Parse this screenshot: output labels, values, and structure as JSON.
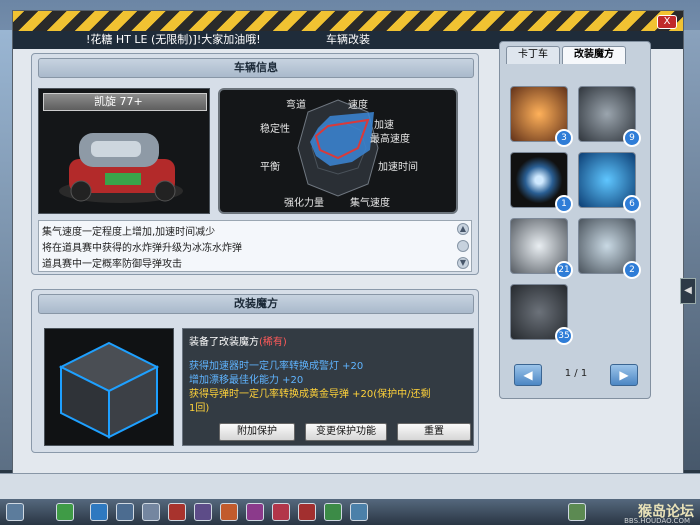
{
  "window": {
    "title": "车辆改装",
    "close_label": "X",
    "marquee": "!花糖 HT LE (无限制)]!大家加油哦!"
  },
  "info_panel": {
    "header": "车辆信息",
    "car_name": "凯旋 77+",
    "radar_labels": [
      "弯道",
      "速度",
      "稳定性",
      "加速",
      "最高速度",
      "平衡",
      "加速时间",
      "强化力量",
      "集气速度"
    ],
    "description": [
      "集气速度一定程度上增加,加速时间减少",
      "将在道具赛中获得的水炸弹升级为冰冻水炸弹",
      "道具赛中一定概率防御导弹攻击"
    ]
  },
  "mod_panel": {
    "header": "改装魔方",
    "equipped_prefix": "装备了改装魔方",
    "equipped_name": "(稀有)",
    "lines": [
      {
        "text": "获得加速器时一定几率转换成警灯 +20",
        "color": "#5fb4ff"
      },
      {
        "text": "增加漂移最佳化能力 +20",
        "color": "#5fb4ff"
      },
      {
        "text": "获得导弹时一定几率转换成黄金导弹 +20(保护中/还剩",
        "color": "#ffd23a"
      },
      {
        "text": "1回)",
        "color": "#ffd23a"
      }
    ],
    "buttons": {
      "protect": "附加保护",
      "change": "变更保护功能",
      "reset": "重置"
    }
  },
  "side_panel": {
    "tabs": [
      "卡丁车",
      "改装魔方"
    ],
    "active_tab": "改装魔方",
    "slots": [
      {
        "badge": "3",
        "icon": "orange-gear-icon"
      },
      {
        "badge": "9",
        "icon": "dark-gear-icon"
      },
      {
        "badge": "1",
        "icon": "blue-ring-icon"
      },
      {
        "badge": "6",
        "icon": "blue-orb-icon"
      },
      {
        "badge": "21",
        "icon": "wrench-icon"
      },
      {
        "badge": "2",
        "icon": "glass-orb-icon"
      },
      {
        "badge": "35",
        "icon": "cube-icon"
      }
    ],
    "pager": "1 / 1"
  },
  "watermark": {
    "title": "猴岛论坛",
    "sub": "BBS.HOUDAO.COM"
  }
}
